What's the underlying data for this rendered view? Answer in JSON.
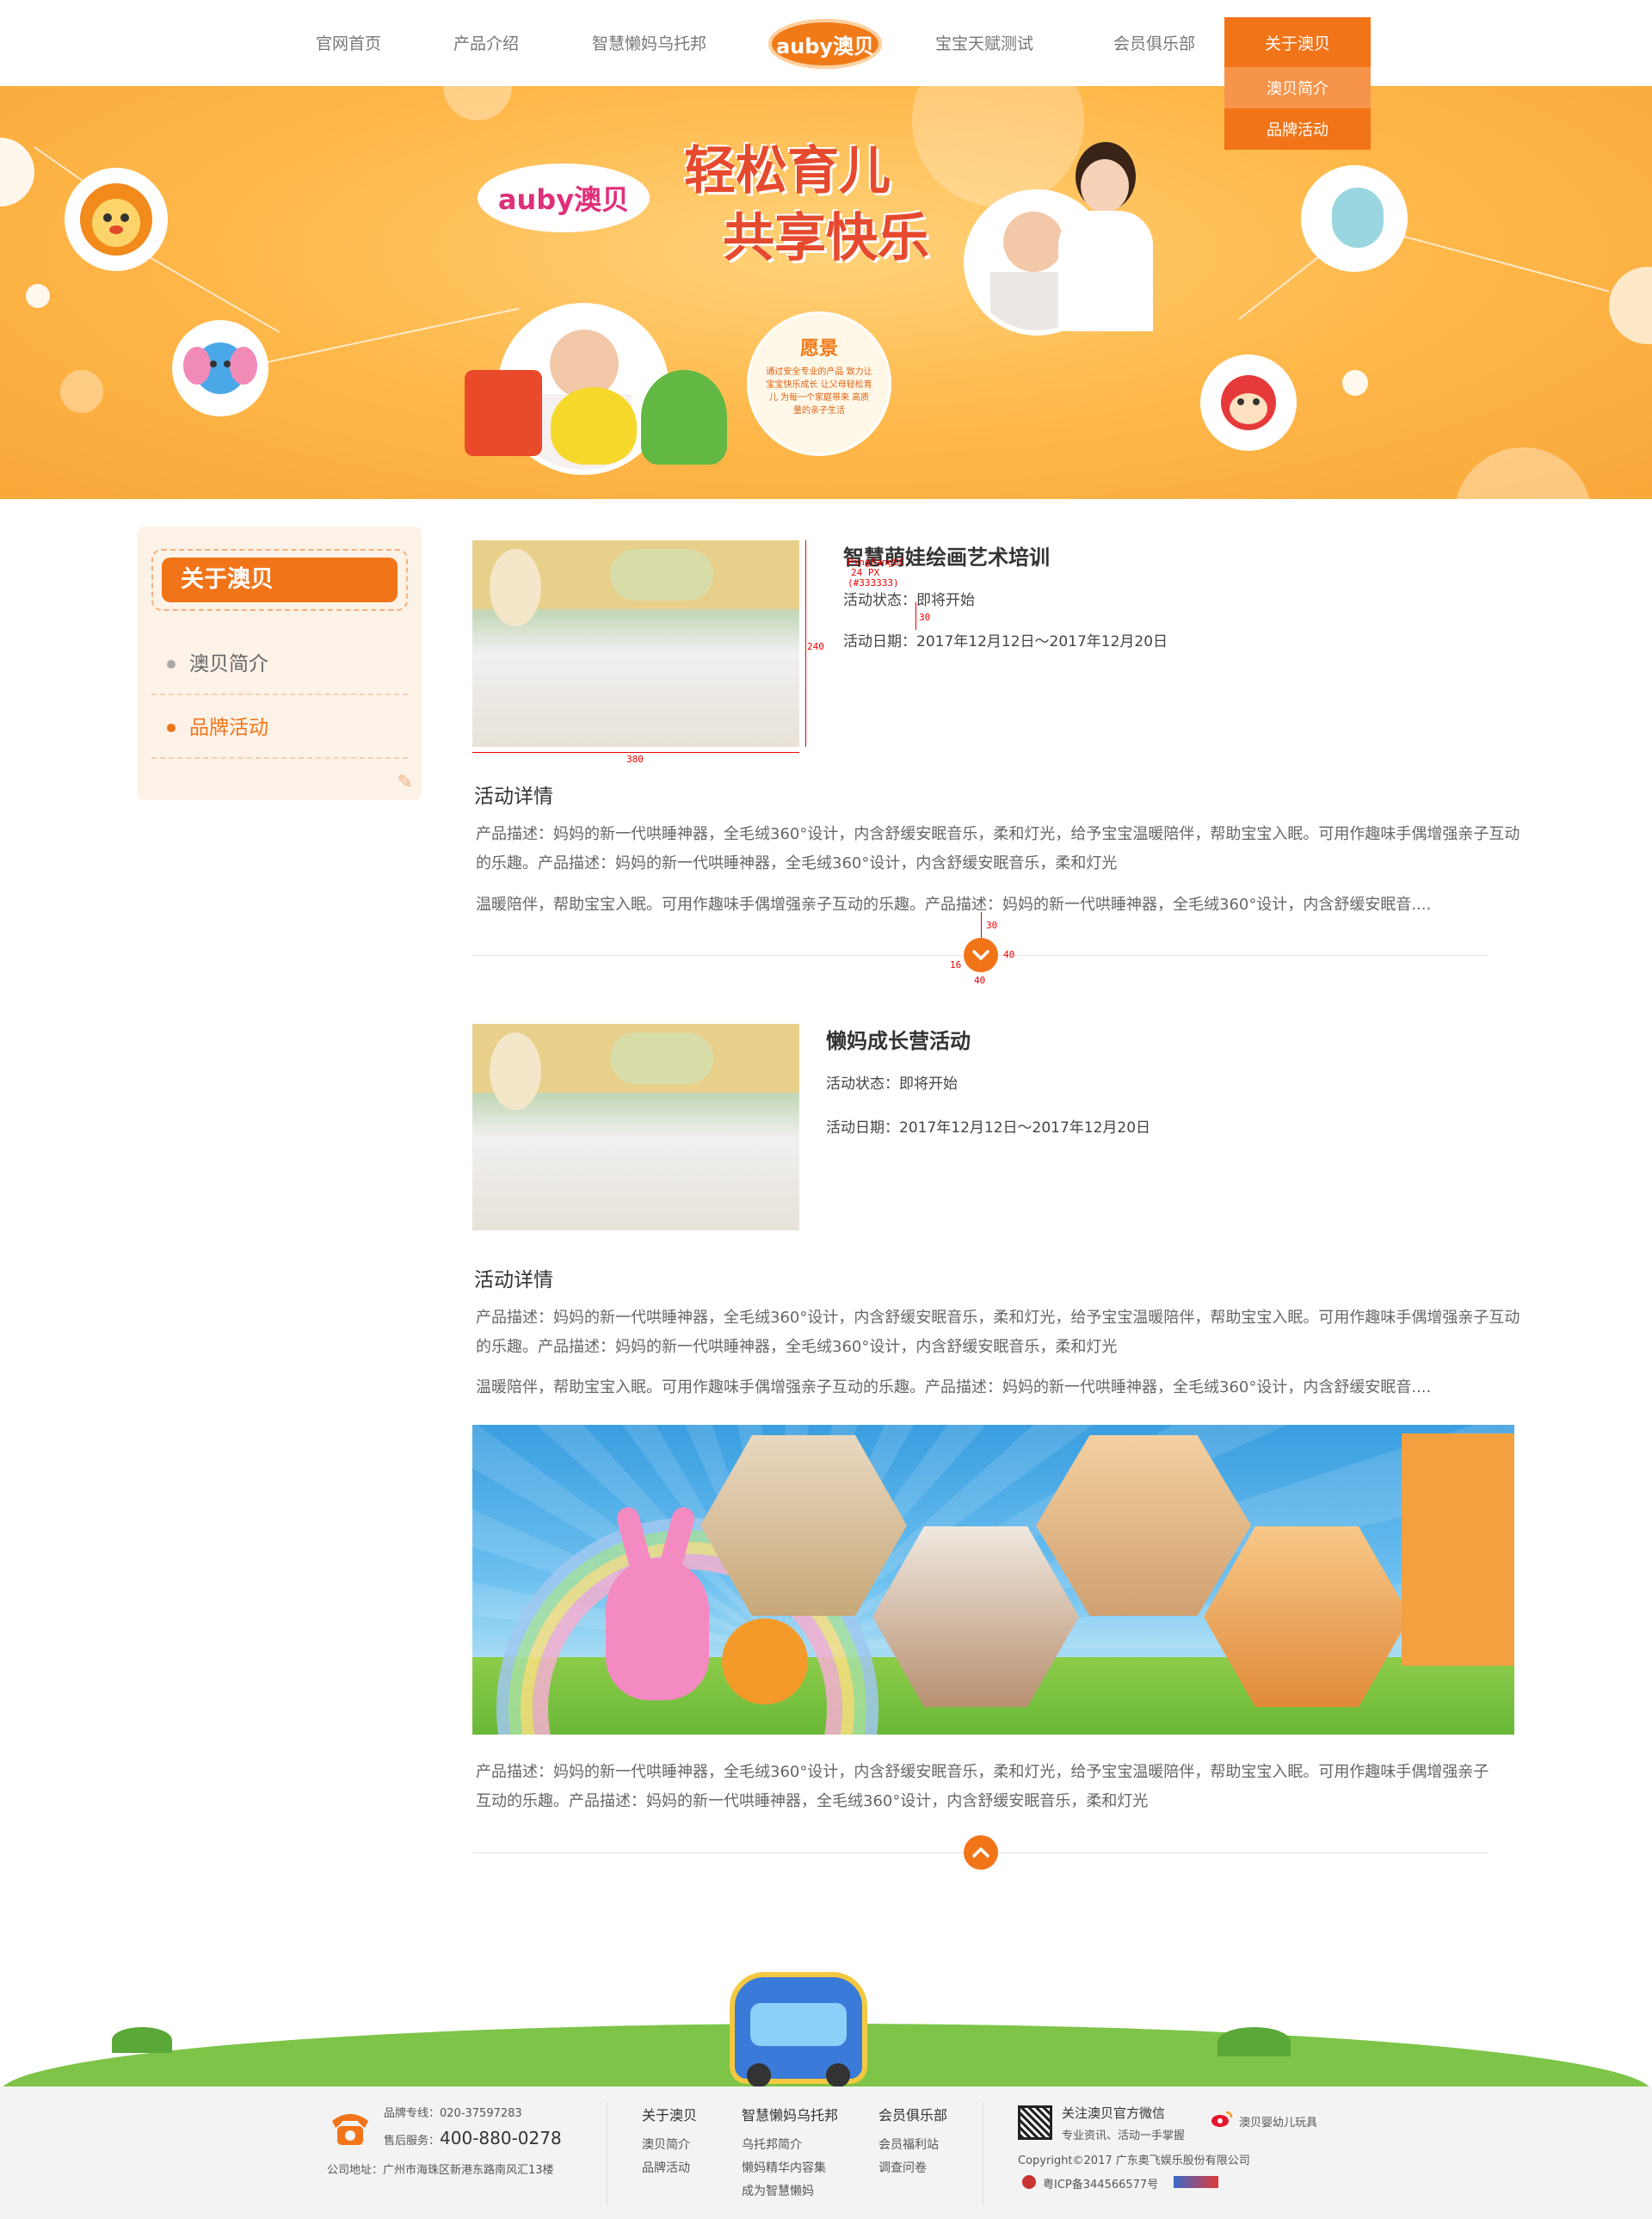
{
  "nav": {
    "items": [
      "官网首页",
      "产品介绍",
      "智慧懒妈乌托邦",
      "宝宝天赋测试",
      "会员俱乐部"
    ],
    "logo": "auby澳贝",
    "active": "关于澳贝",
    "dropdown": [
      "澳贝简介",
      "品牌活动"
    ]
  },
  "banner": {
    "logo": "auby澳贝",
    "slogan_line1": "轻松育儿",
    "slogan_line2": "共享快乐",
    "vision_title": "愿景",
    "vision_text": "通过安全专业的产品 致力让宝宝快乐成长 让父母轻松育儿 为每一个家庭带来 高质量的亲子生活"
  },
  "sidebar": {
    "title": "关于澳贝",
    "items": [
      "澳贝简介",
      "品牌活动"
    ],
    "active_index": 1
  },
  "activities": [
    {
      "title": "智慧萌娃绘画艺术培训",
      "status_label": "活动状态：",
      "status": "即将开始",
      "date_label": "活动日期：",
      "date": "2017年12月12日～2017年12月20日",
      "details_heading": "活动详情",
      "para1": "产品描述：妈妈的新一代哄睡神器，全毛绒360°设计，内含舒缓安眠音乐，柔和灯光，给予宝宝温暖陪伴，帮助宝宝入眠。可用作趣味手偶增强亲子互动的乐趣。产品描述：妈妈的新一代哄睡神器，全毛绒360°设计，内含舒缓安眠音乐，柔和灯光",
      "para2": "温暖陪伴，帮助宝宝入眠。可用作趣味手偶增强亲子互动的乐趣。产品描述：妈妈的新一代哄睡神器，全毛绒360°设计，内含舒缓安眠音...."
    },
    {
      "title": "懒妈成长营活动",
      "status_label": "活动状态：",
      "status": "即将开始",
      "date_label": "活动日期：",
      "date": "2017年12月12日～2017年12月20日",
      "details_heading": "活动详情",
      "para1": "产品描述：妈妈的新一代哄睡神器，全毛绒360°设计，内含舒缓安眠音乐，柔和灯光，给予宝宝温暖陪伴，帮助宝宝入眠。可用作趣味手偶增强亲子互动的乐趣。产品描述：妈妈的新一代哄睡神器，全毛绒360°设计，内含舒缓安眠音乐，柔和灯光",
      "para2": "温暖陪伴，帮助宝宝入眠。可用作趣味手偶增强亲子互动的乐趣。产品描述：妈妈的新一代哄睡神器，全毛绒360°设计，内含舒缓安眠音....",
      "para3": "产品描述：妈妈的新一代哄睡神器，全毛绒360°设计，内含舒缓安眠音乐，柔和灯光，给予宝宝温暖陪伴，帮助宝宝入眠。可用作趣味手偶增强亲子互动的乐趣。产品描述：妈妈的新一代哄睡神器，全毛绒360°设计，内含舒缓安眠音乐，柔和灯光"
    }
  ],
  "annotations": {
    "font": "PingFangSC",
    "size": "24 PX",
    "color": "(#333333)",
    "gap30": "30",
    "h240": "240",
    "w380": "380",
    "btn30": "30",
    "btn16": "16",
    "btn40h": "40",
    "btn40w": "40"
  },
  "footer": {
    "hotline_label": "品牌专线：020-37597283",
    "service_label": "售后服务：",
    "service_phone": "400-880-0278",
    "address": "公司地址：广州市海珠区新港东路南风汇13楼",
    "col1_head": "关于澳贝",
    "col1_items": [
      "澳贝简介",
      "品牌活动"
    ],
    "col2_head": "智慧懒妈乌托邦",
    "col2_items": [
      "乌托邦简介",
      "懒妈精华内容集",
      "成为智慧懒妈"
    ],
    "col3_head": "会员俱乐部",
    "col3_items": [
      "会员福利站",
      "调查问卷"
    ],
    "wechat_title": "关注澳贝官方微信",
    "wechat_sub": "专业资讯、活动一手掌握",
    "weibo": "澳贝婴幼儿玩具",
    "copyright": "Copyright©2017 广东奥飞娱乐股份有限公司",
    "icp": "粤ICP备344566577号"
  },
  "colors": {
    "accent": "#f27418",
    "text": "#333333",
    "muted": "#666666"
  }
}
